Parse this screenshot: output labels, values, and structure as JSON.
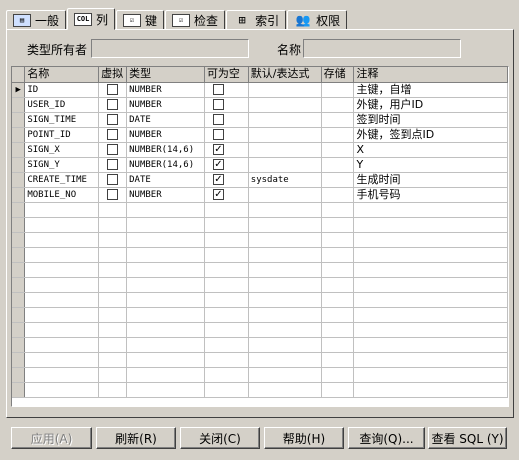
{
  "tabs": [
    {
      "label": "一般",
      "icon": "general-icon"
    },
    {
      "label": "列",
      "icon": "column-icon"
    },
    {
      "label": "键",
      "icon": "key-icon"
    },
    {
      "label": "检查",
      "icon": "check-icon"
    },
    {
      "label": "索引",
      "icon": "index-icon"
    },
    {
      "label": "权限",
      "icon": "privileges-icon"
    }
  ],
  "form": {
    "type_owner_label": "类型所有者",
    "type_owner_value": "",
    "name_label": "名称",
    "name_value": ""
  },
  "grid": {
    "headers": [
      "名称",
      "虚拟",
      "类型",
      "可为空",
      "默认/表达式",
      "存储",
      "注释"
    ],
    "rows": [
      {
        "name": "ID",
        "type": "NUMBER",
        "nullable": false,
        "default": "",
        "comment": "主键，自增"
      },
      {
        "name": "USER_ID",
        "type": "NUMBER",
        "nullable": false,
        "default": "",
        "comment": "外键，用户ID"
      },
      {
        "name": "SIGN_TIME",
        "type": "DATE",
        "nullable": false,
        "default": "",
        "comment": "签到时间"
      },
      {
        "name": "POINT_ID",
        "type": "NUMBER",
        "nullable": false,
        "default": "",
        "comment": "外键，签到点ID"
      },
      {
        "name": "SIGN_X",
        "type": "NUMBER(14,6)",
        "nullable": true,
        "default": "",
        "comment": "X"
      },
      {
        "name": "SIGN_Y",
        "type": "NUMBER(14,6)",
        "nullable": true,
        "default": "",
        "comment": "Y"
      },
      {
        "name": "CREATE_TIME",
        "type": "DATE",
        "nullable": true,
        "default": "sysdate",
        "comment": "生成时间"
      },
      {
        "name": "MOBILE_NO",
        "type": "NUMBER",
        "nullable": true,
        "default": "",
        "comment": "手机号码"
      }
    ]
  },
  "buttons": {
    "apply": "应用(A)",
    "refresh": "刷新(R)",
    "close": "关闭(C)",
    "help": "帮助(H)",
    "query": "查询(Q)...",
    "view_sql": "查看 SQL (Y)"
  }
}
